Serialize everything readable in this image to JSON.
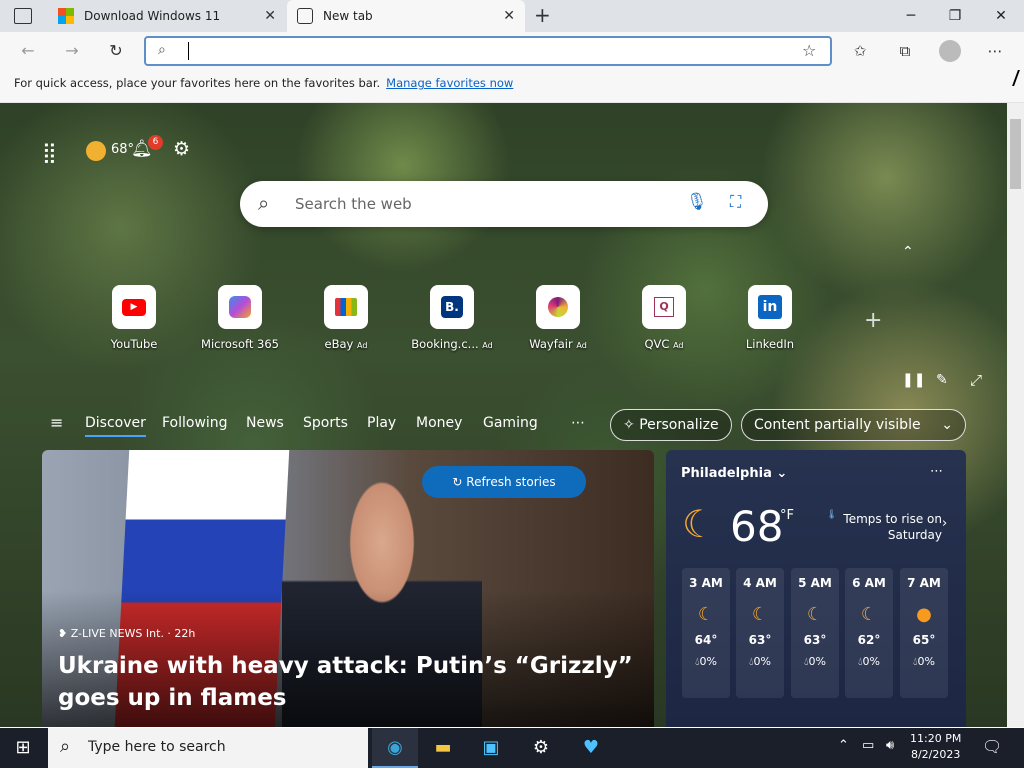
{
  "browser": {
    "tabs": [
      {
        "title": "Download Windows 11"
      },
      {
        "title": "New tab"
      }
    ],
    "favorites_bar": {
      "message": "For quick access, place your favorites here on the favorites bar.",
      "link": "Manage favorites now"
    }
  },
  "newtab": {
    "temperature_small": "68°",
    "notification_count": "6",
    "search_placeholder": "Search the web",
    "quick_links": [
      {
        "label": "YouTube",
        "ad": ""
      },
      {
        "label": "Microsoft 365",
        "ad": ""
      },
      {
        "label": "eBay",
        "ad": "Ad"
      },
      {
        "label": "Booking.c...",
        "ad": "Ad"
      },
      {
        "label": "Wayfair",
        "ad": "Ad"
      },
      {
        "label": "QVC",
        "ad": "Ad"
      },
      {
        "label": "LinkedIn",
        "ad": ""
      }
    ],
    "nav": [
      "Discover",
      "Following",
      "News",
      "Sports",
      "Play",
      "Money",
      "Gaming"
    ],
    "personalize": "Personalize",
    "content_visibility": "Content partially visible",
    "hero": {
      "refresh": "Refresh stories",
      "source": "Z-LIVE NEWS Int. · 22h",
      "headline": "Ukraine with heavy attack: Putin’s “Grizzly” goes up in flames"
    },
    "weather": {
      "city": "Philadelphia",
      "temp": "68",
      "unit": "°F",
      "note": "Temps to rise on Saturday",
      "hours": [
        {
          "time": "3 AM",
          "temp": "64°",
          "precip": "0%",
          "icon": "moon"
        },
        {
          "time": "4 AM",
          "temp": "63°",
          "precip": "0%",
          "icon": "moon"
        },
        {
          "time": "5 AM",
          "temp": "63°",
          "precip": "0%",
          "icon": "moon"
        },
        {
          "time": "6 AM",
          "temp": "62°",
          "precip": "0%",
          "icon": "moon"
        },
        {
          "time": "7 AM",
          "temp": "65°",
          "precip": "0%",
          "icon": "sun"
        }
      ]
    }
  },
  "taskbar": {
    "search_placeholder": "Type here to search",
    "time": "11:20 PM",
    "date": "8/2/2023"
  }
}
